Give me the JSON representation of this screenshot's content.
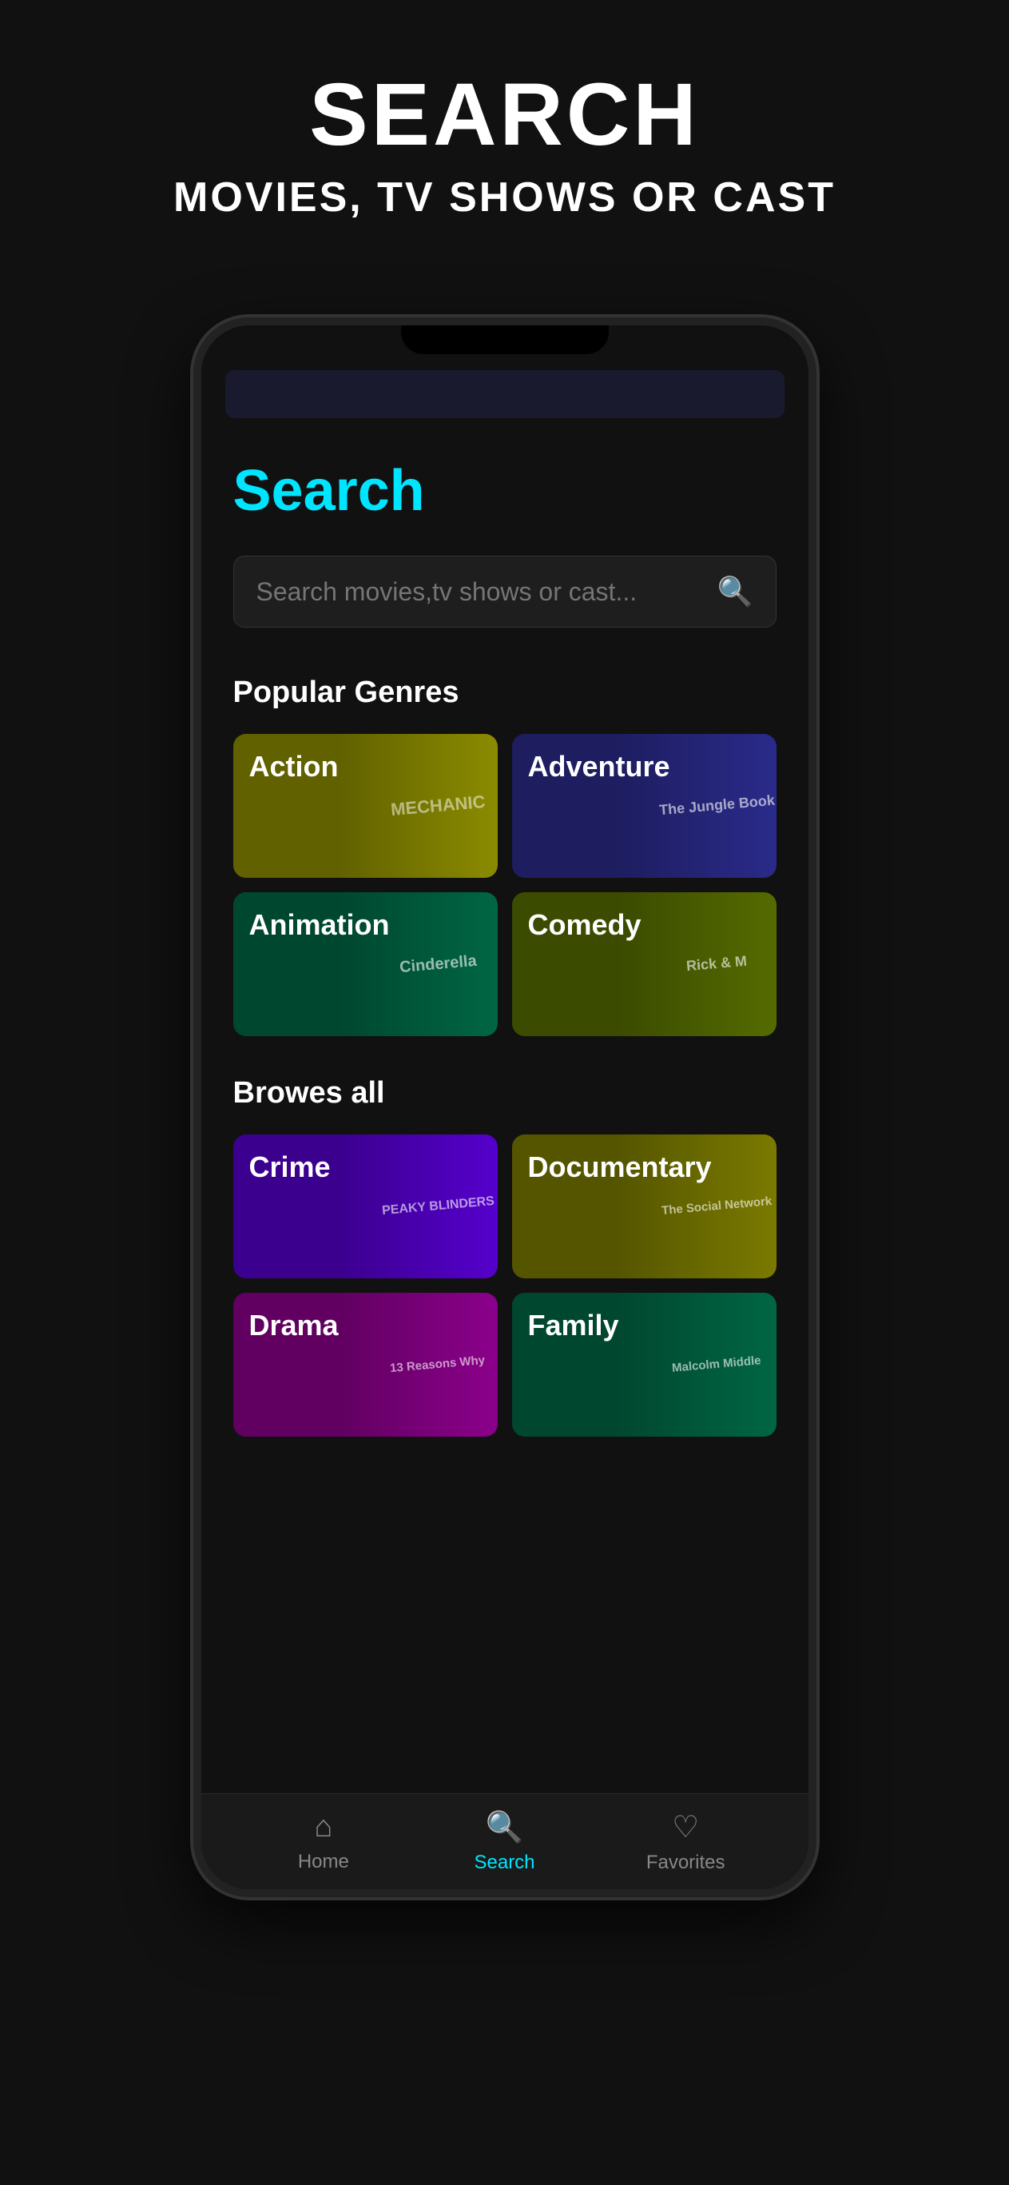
{
  "promo": {
    "title": "SEARCH",
    "subtitle": "MOVIES, TV SHOWS OR CAST"
  },
  "search_page": {
    "heading": "Search",
    "search_placeholder": "Search movies,tv shows or cast...",
    "popular_genres_label": "Popular Genres",
    "browse_all_label": "Browes all",
    "genres_popular": [
      {
        "id": "action",
        "label": "Action",
        "color": "genre-action",
        "poster": "MECHANIC"
      },
      {
        "id": "adventure",
        "label": "Adventure",
        "color": "genre-adventure",
        "poster": "The Jungle Book"
      },
      {
        "id": "animation",
        "label": "Animation",
        "color": "genre-animation",
        "poster": "Cinderella"
      },
      {
        "id": "comedy",
        "label": "Comedy",
        "color": "genre-comedy",
        "poster": "Rick & M"
      }
    ],
    "genres_browse": [
      {
        "id": "crime",
        "label": "Crime",
        "color": "genre-crime",
        "poster": "PEAKY BLINDERS"
      },
      {
        "id": "documentary",
        "label": "Documentary",
        "color": "genre-documentary",
        "poster": "The Social Network"
      },
      {
        "id": "drama",
        "label": "Drama",
        "color": "genre-drama",
        "poster": "13 Reasons Why"
      },
      {
        "id": "family",
        "label": "Family",
        "color": "genre-family",
        "poster": "Malcolm Middle"
      }
    ]
  },
  "bottom_nav": {
    "items": [
      {
        "id": "home",
        "label": "Home",
        "icon": "⌂",
        "active": false
      },
      {
        "id": "search",
        "label": "Search",
        "icon": "⊕",
        "active": true
      },
      {
        "id": "favorites",
        "label": "Favorites",
        "icon": "♡",
        "active": false
      }
    ]
  }
}
